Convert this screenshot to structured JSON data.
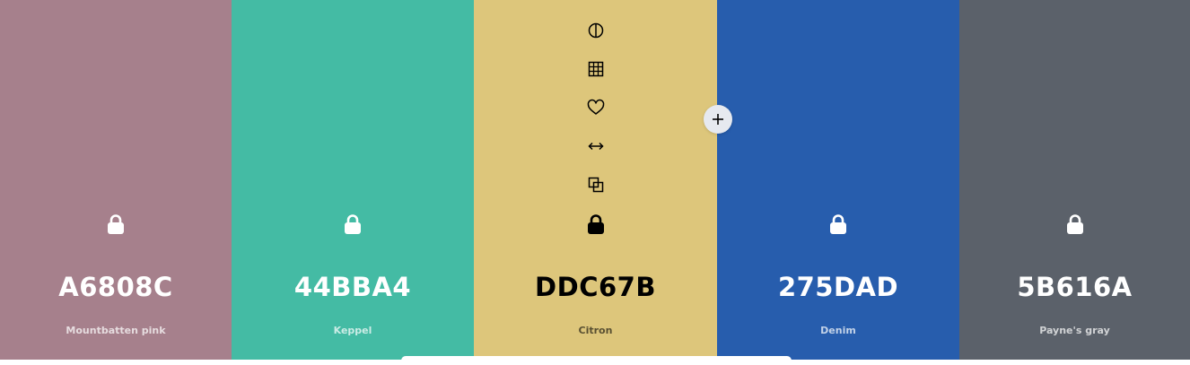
{
  "palette": [
    {
      "hex": "A6808C",
      "name": "Mountbatten pink",
      "color": "#A6808C",
      "text_tone": "light"
    },
    {
      "hex": "44BBA4",
      "name": "Keppel",
      "color": "#44BBA4",
      "text_tone": "light"
    },
    {
      "hex": "DDC67B",
      "name": "Citron",
      "color": "#DDC67B",
      "text_tone": "dark"
    },
    {
      "hex": "275DAD",
      "name": "Denim",
      "color": "#275DAD",
      "text_tone": "light"
    },
    {
      "hex": "5B616A",
      "name": "Payne's gray",
      "color": "#5B616A",
      "text_tone": "light"
    }
  ],
  "hovered_swatch": 2,
  "hover_tools": [
    "contrast-icon",
    "shades-grid-icon",
    "heart-icon",
    "drag-arrows-icon",
    "copy-icon"
  ],
  "lock_icon": "lock-icon",
  "add_icon": "plus-icon"
}
